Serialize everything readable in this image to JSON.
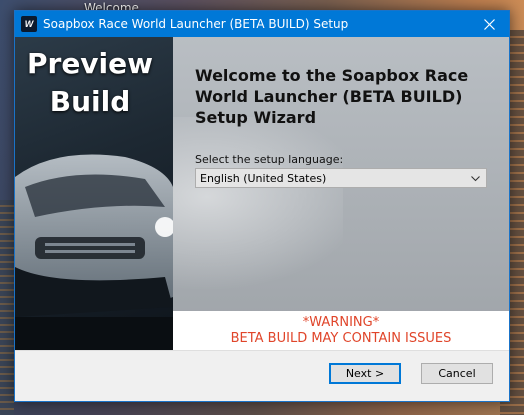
{
  "desktop": {
    "label": "Welcome"
  },
  "window": {
    "title": "Soapbox Race World Launcher (BETA BUILD) Setup",
    "app_icon_text": "W"
  },
  "banner": {
    "line1": "Preview",
    "line2": "Build"
  },
  "content": {
    "heading": "Welcome to the Soapbox Race World Launcher (BETA BUILD) Setup Wizard",
    "language_label": "Select the setup language:",
    "language_selected": "English (United States)"
  },
  "warning": {
    "line1": "*WARNING*",
    "line2": "BETA BUILD MAY CONTAIN ISSUES"
  },
  "footer": {
    "next_label": "Next >",
    "cancel_label": "Cancel"
  },
  "colors": {
    "titlebar": "#0078d7",
    "warning": "#e0452a"
  }
}
